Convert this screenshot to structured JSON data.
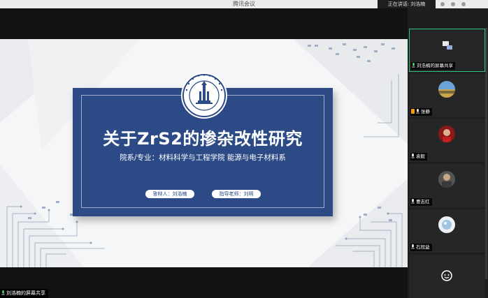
{
  "window": {
    "title": "腾讯会议",
    "speaking": "正在讲话: 刘浩楠"
  },
  "slide": {
    "title": "关于ZrS2的掺杂改性研究",
    "subtitle": "院系/专业：材料科学与工程学院 能源与电子材料系",
    "presenter": "答辩人：刘浩楠",
    "advisor": "指导老师：刘明"
  },
  "share_label": "刘浩楠的屏幕共享",
  "participants": [
    {
      "name": "刘浩楠的屏幕共享",
      "active": true
    },
    {
      "name": "张静"
    },
    {
      "name": "袁毅"
    },
    {
      "name": "曹志红"
    },
    {
      "name": "石冠益"
    },
    {
      "name": ""
    }
  ],
  "colors": {
    "card_blue": "#2b4a86",
    "active_border": "#2ec27e",
    "muted_mic": "#f0a000"
  }
}
